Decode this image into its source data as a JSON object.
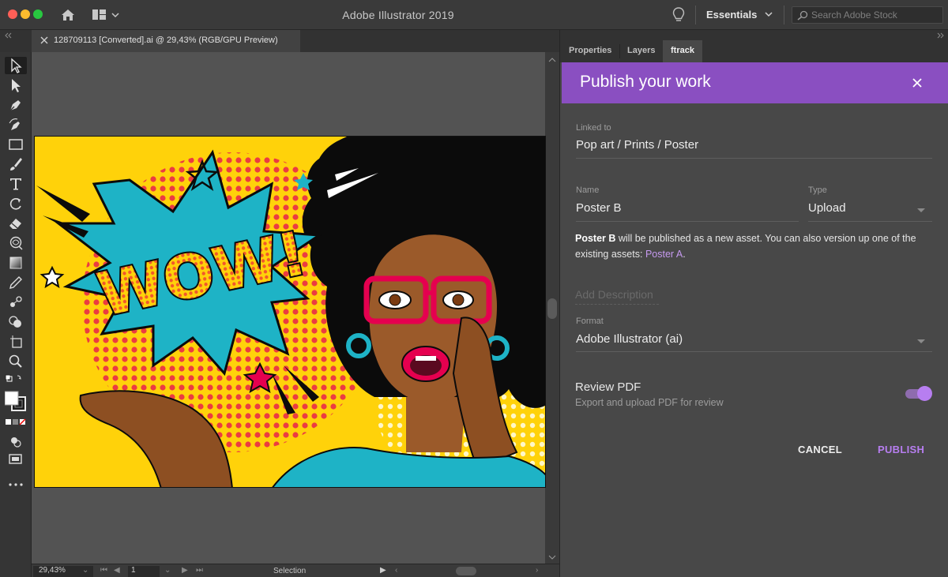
{
  "app": {
    "title": "Adobe Illustrator 2019",
    "workspace": "Essentials",
    "stock_search_placeholder": "Search Adobe Stock"
  },
  "document": {
    "tab_title": "128709113 [Converted].ai @ 29,43% (RGB/GPU Preview)"
  },
  "statusbar": {
    "zoom": "29,43%",
    "page": "1",
    "tool": "Selection"
  },
  "panel": {
    "tabs": [
      "Properties",
      "Layers",
      "ftrack"
    ],
    "active_tab": "ftrack"
  },
  "publish": {
    "title": "Publish your work",
    "linked_to_label": "Linked to",
    "linked_to_value": "Pop art / Prints / Poster",
    "name_label": "Name",
    "name_value": "Poster B",
    "type_label": "Type",
    "type_value": "Upload",
    "info_name": "Poster B",
    "info_text": " will be published as a new asset. You can also version up one of the existing assets: ",
    "info_link": "Poster A",
    "info_end": ".",
    "description_placeholder": "Add Description",
    "format_label": "Format",
    "format_value": "Adobe Illustrator (ai)",
    "review_title": "Review PDF",
    "review_subtitle": "Export and upload PDF for review",
    "review_enabled": true,
    "cancel_label": "CANCEL",
    "publish_label": "PUBLISH"
  },
  "artwork": {
    "text": "WOW!"
  },
  "colors": {
    "accent_purple": "#8a4fc1",
    "publish_text": "#b77ef0",
    "link": "#c69af0",
    "art_yellow": "#ffd20a",
    "art_cyan": "#1eb3c6",
    "art_pink": "#e5004f"
  }
}
